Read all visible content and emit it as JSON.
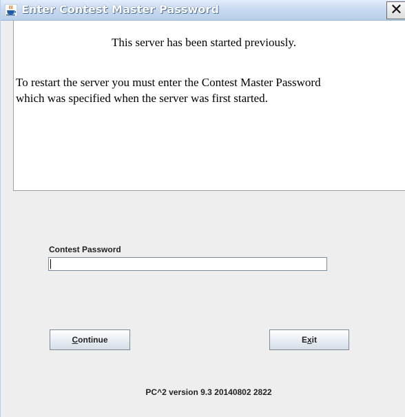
{
  "window": {
    "title": "Enter Contest Master Password",
    "close_glyph": "✕",
    "icon": "java-cup-icon"
  },
  "message": {
    "line1": "This server has been started previously.",
    "para_line1": "To restart the server you must enter the Contest Master Password",
    "para_line2": "which was specified when the server was first started."
  },
  "form": {
    "password_label": "Contest Password",
    "password_value": ""
  },
  "buttons": {
    "continue_mnemonic": "C",
    "continue_rest": "ontinue",
    "exit_pre": "E",
    "exit_mnemonic": "x",
    "exit_post": "it"
  },
  "footer": {
    "version": "PC^2 version 9.3 20140802 2822"
  },
  "colors": {
    "titlebar": "#c9daf0",
    "title_text": "#ffffff",
    "panel_bg": "#eeeeee",
    "message_bg": "#ffffff"
  }
}
